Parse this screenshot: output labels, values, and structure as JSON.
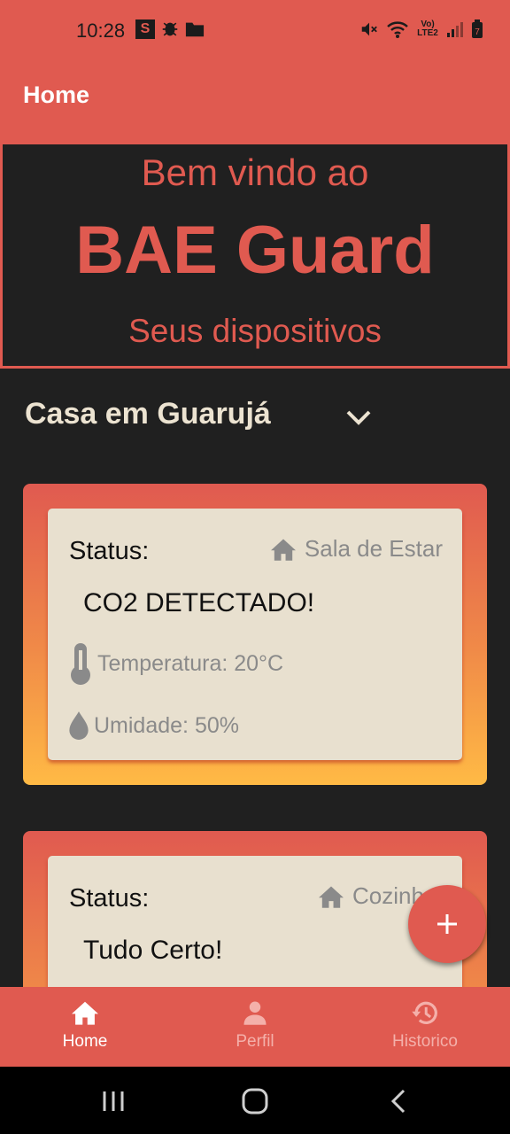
{
  "status_bar": {
    "time": "10:28",
    "left_icons": [
      "s-app-icon",
      "bug-icon",
      "folder-icon"
    ],
    "right_icons": [
      "mute-icon",
      "wifi-icon",
      "volte-icon",
      "signal-icon",
      "battery-icon"
    ],
    "network_label": "Vo) LTE2",
    "battery_level": "7"
  },
  "app_bar": {
    "title": "Home"
  },
  "banner": {
    "welcome": "Bem vindo ao",
    "brand": "BAE Guard",
    "subtitle": "Seus dispositivos"
  },
  "location_selector": {
    "value": "Casa em Guarujá",
    "icon": "chevron-down-icon"
  },
  "devices": [
    {
      "status_label": "Status:",
      "room": "Sala de Estar",
      "status": "CO2 DETECTADO!",
      "temperature": "Temperatura: 20°C",
      "humidity": "Umidade: 50%"
    },
    {
      "status_label": "Status:",
      "room": "Cozinh",
      "status": "Tudo Certo!"
    }
  ],
  "fab": {
    "icon": "plus-icon"
  },
  "bottom_nav": [
    {
      "label": "Home",
      "icon": "home-icon",
      "active": true
    },
    {
      "label": "Perfil",
      "icon": "person-icon",
      "active": false
    },
    {
      "label": "Historico",
      "icon": "history-icon",
      "active": false
    }
  ],
  "colors": {
    "accent": "#e05a50",
    "background": "#202020",
    "card": "#e8e0cf",
    "gradient_end": "#ffba45",
    "muted_text": "#8a8a8a"
  }
}
